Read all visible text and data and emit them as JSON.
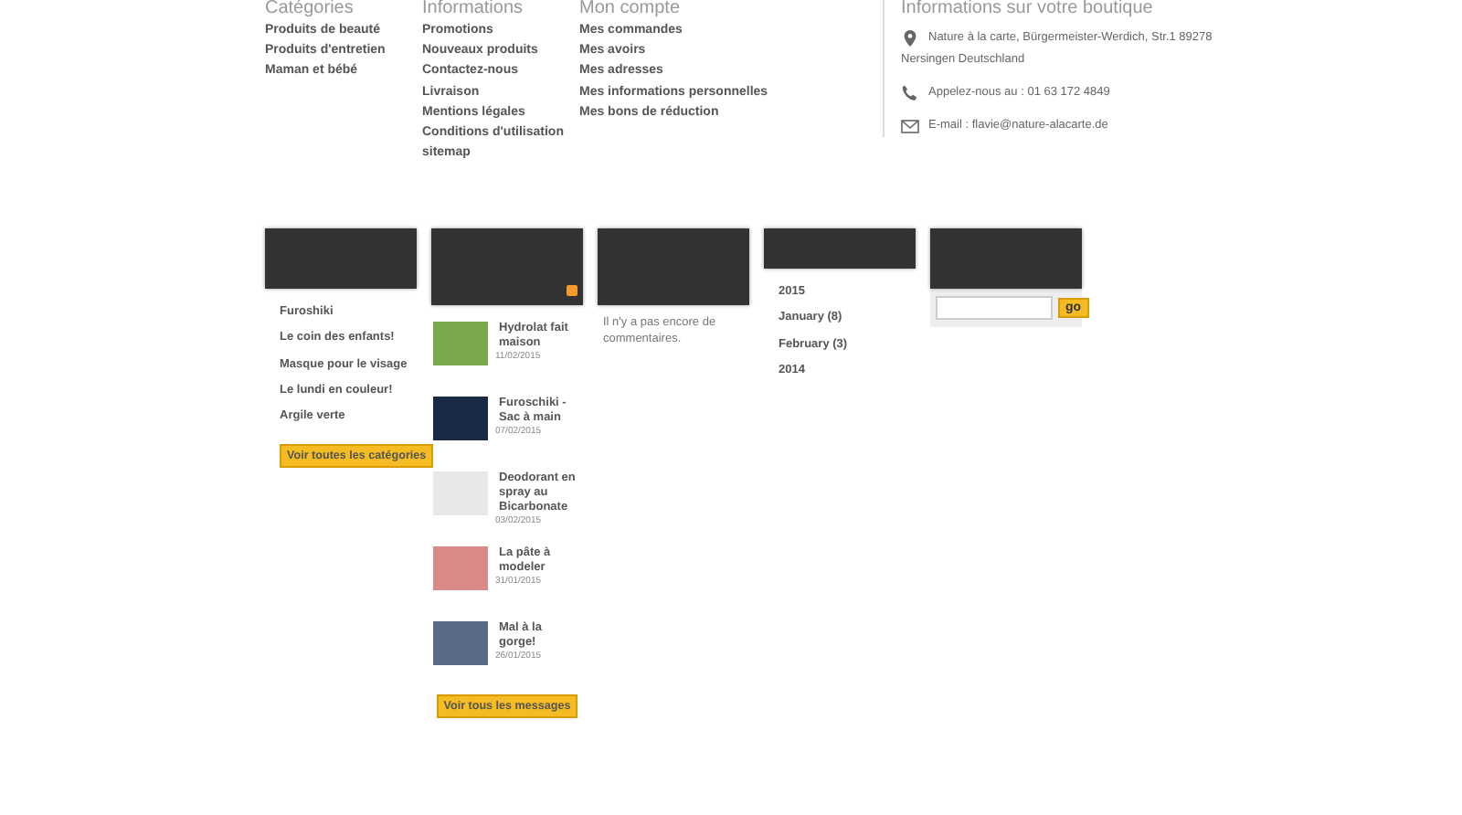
{
  "footer": {
    "columns": [
      {
        "heading": "Catégories",
        "links": [
          "Produits de beauté",
          "Produits d'entretien",
          "Maman et bébé"
        ]
      },
      {
        "heading": "Informations",
        "links": [
          "Promotions",
          "Nouveaux produits",
          "Contactez-nous",
          "Livraison",
          "Mentions légales",
          "Conditions d'utilisation",
          "sitemap"
        ]
      },
      {
        "heading": "Mon compte",
        "links": [
          "Mes commandes",
          "Mes avoirs",
          "Mes adresses",
          "Mes informations personnelles",
          "Mes bons de réduction"
        ]
      }
    ],
    "contact": {
      "heading": "Informations sur votre boutique",
      "items": [
        {
          "kind": "address",
          "lines": [
            "Nature à la carte, Bürgermeister-Werdich, Str.1 89278",
            "Nersingen Deutschland"
          ]
        },
        {
          "kind": "phone",
          "lines": [
            "Appelez-nous au : 01 63 172 4849"
          ]
        },
        {
          "kind": "email",
          "lines": [
            "E-mail : flavie@nature-alacarte.de"
          ]
        }
      ]
    }
  },
  "widgets": {
    "categories": {
      "items": [
        "Furoshiki",
        "Le coin des enfants!",
        "Masque pour le visage",
        "Le lundi en couleur!",
        "Argile verte"
      ],
      "button": "Voir toutes les catégories"
    },
    "posts": {
      "items": [
        {
          "title": "Hydrolat fait maison",
          "date": "11/02/2015"
        },
        {
          "title": "Furoschiki - Sac à main",
          "date": "07/02/2015"
        },
        {
          "title": "Deodorant en spray au Bicarbonate",
          "date": "03/02/2015"
        },
        {
          "title": "La pâte à modeler",
          "date": "31/01/2015"
        },
        {
          "title": "Mal à la gorge!",
          "date": "26/01/2015"
        }
      ],
      "button": "Voir tous les messages"
    },
    "comments": {
      "text": "Il n'y a pas encore de commentaires."
    },
    "archives": {
      "items": [
        "2015",
        "January (8)",
        "February (3)",
        "2014"
      ]
    },
    "search": {
      "button": "go"
    }
  }
}
